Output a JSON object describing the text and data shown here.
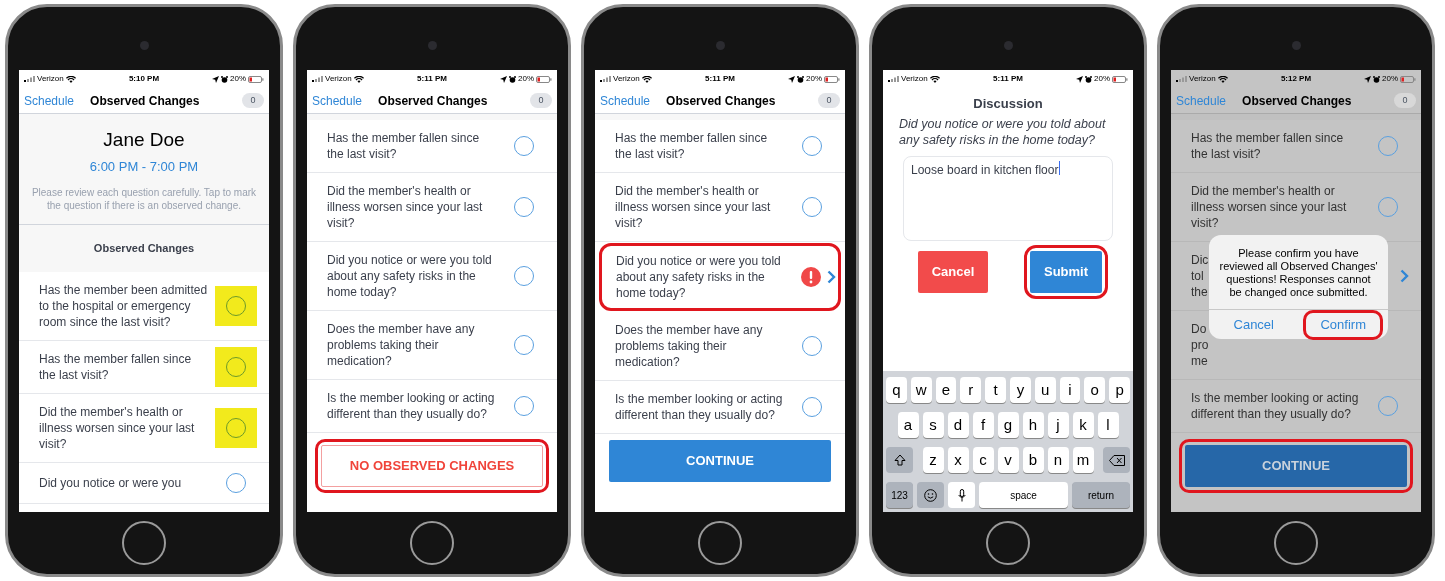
{
  "phones": [
    {
      "kind": "questions",
      "dimmed": false,
      "status_bar": {
        "carrier": "Verizon",
        "time": "5:10 PM",
        "battery": "20%"
      },
      "nav": {
        "back": "Schedule",
        "title": "Observed Changes",
        "badge": "0"
      },
      "member": {
        "name": "Jane Doe",
        "time": "6:00 PM - 7:00 PM",
        "instructions": "Please review each question carefully. Tap to mark the question if there is an observed change."
      },
      "section_title": "Observed Changes",
      "questions": [
        {
          "text": "Has the member been admitted to the hospital or emergency room since the last visit?",
          "marked": false,
          "highlighted": true,
          "outlined": false,
          "covered": false
        },
        {
          "text": "Has the member fallen since the last visit?",
          "marked": false,
          "highlighted": true,
          "outlined": false,
          "covered": false
        },
        {
          "text": "Did the member's health or illness worsen since your last visit?",
          "marked": false,
          "highlighted": true,
          "outlined": false,
          "covered": false
        },
        {
          "text": "Did you notice or were you",
          "marked": false,
          "highlighted": false,
          "outlined": false,
          "covered": false
        }
      ]
    },
    {
      "kind": "questions",
      "dimmed": false,
      "status_bar": {
        "carrier": "Verizon",
        "time": "5:11 PM",
        "battery": "20%"
      },
      "nav": {
        "back": "Schedule",
        "title": "Observed Changes",
        "badge": "0"
      },
      "questions": [
        {
          "text": "Has the member fallen since the last visit?",
          "marked": false,
          "highlighted": false,
          "outlined": false,
          "covered": false
        },
        {
          "text": "Did the member's health or illness worsen since your last visit?",
          "marked": false,
          "highlighted": false,
          "outlined": false,
          "covered": false
        },
        {
          "text": "Did you notice or were you told about any safety risks in the home today?",
          "marked": false,
          "highlighted": false,
          "outlined": false,
          "covered": false
        },
        {
          "text": "Does the member have any problems taking their medication?",
          "marked": false,
          "highlighted": false,
          "outlined": false,
          "covered": false
        },
        {
          "text": "Is the member looking or acting different than they usually do?",
          "marked": false,
          "highlighted": false,
          "outlined": false,
          "covered": false
        }
      ],
      "footer_button": {
        "label": "NO OBSERVED CHANGES",
        "kind": "outline",
        "outlined": true
      }
    },
    {
      "kind": "questions",
      "dimmed": false,
      "status_bar": {
        "carrier": "Verizon",
        "time": "5:11 PM",
        "battery": "20%"
      },
      "nav": {
        "back": "Schedule",
        "title": "Observed Changes",
        "badge": "0"
      },
      "questions": [
        {
          "text": "Has the member fallen since the last visit?",
          "marked": false,
          "highlighted": false,
          "outlined": false,
          "covered": false
        },
        {
          "text": "Did the member's health or illness worsen since your last visit?",
          "marked": false,
          "highlighted": false,
          "outlined": false,
          "covered": false
        },
        {
          "text": "Did you notice or were you told about any safety risks in the home today?",
          "marked": true,
          "highlighted": false,
          "outlined": true,
          "covered": false
        },
        {
          "text": "Does the member have any problems taking their medication?",
          "marked": false,
          "highlighted": false,
          "outlined": false,
          "covered": false
        },
        {
          "text": "Is the member looking or acting different than they usually do?",
          "marked": false,
          "highlighted": false,
          "outlined": false,
          "covered": false
        }
      ],
      "footer_button": {
        "label": "CONTINUE",
        "kind": "solid",
        "outlined": false
      }
    },
    {
      "kind": "discussion",
      "status_bar": {
        "carrier": "Verizon",
        "time": "5:11 PM",
        "battery": "20%"
      },
      "title": "Discussion",
      "question": "Did you notice or were you told about any safety risks in the home today?",
      "answer": "Loose board in kitchen floor",
      "buttons": [
        {
          "label": "Cancel",
          "kind": "cancel",
          "outlined": false
        },
        {
          "label": "Submit",
          "kind": "submit",
          "outlined": true
        }
      ],
      "keyboard": {
        "rows": [
          [
            "q",
            "w",
            "e",
            "r",
            "t",
            "y",
            "u",
            "i",
            "o",
            "p"
          ],
          [
            "a",
            "s",
            "d",
            "f",
            "g",
            "h",
            "j",
            "k",
            "l"
          ],
          [
            "z",
            "x",
            "c",
            "v",
            "b",
            "n",
            "m"
          ]
        ],
        "numbers_key": "123",
        "space_key": "space",
        "return_key": "return"
      }
    },
    {
      "kind": "questions",
      "dimmed": true,
      "status_bar": {
        "carrier": "Verizon",
        "time": "5:12 PM",
        "battery": "20%"
      },
      "nav": {
        "back": "Schedule",
        "title": "Observed Changes",
        "badge": "0"
      },
      "questions": [
        {
          "text": "Has the member fallen since the last visit?",
          "marked": false,
          "highlighted": false,
          "outlined": false,
          "covered": false
        },
        {
          "text": "Did the member's health or illness worsen since your last visit?",
          "marked": false,
          "highlighted": false,
          "outlined": false,
          "covered": false
        },
        {
          "text": "Dic\ntol\nthe",
          "marked": true,
          "highlighted": false,
          "outlined": false,
          "covered": true
        },
        {
          "text": "Do\npro\nme",
          "marked": false,
          "highlighted": false,
          "outlined": false,
          "covered": true
        },
        {
          "text": "Is the member looking or acting different than they usually do?",
          "marked": false,
          "highlighted": false,
          "outlined": false,
          "covered": false
        }
      ],
      "footer_button": {
        "label": "CONTINUE",
        "kind": "solid",
        "outlined": true
      },
      "dialog": {
        "message": "Please confirm you have reviewed all Observed Changes' questions! Responses cannot be changed once submitted.",
        "buttons": [
          {
            "label": "Cancel",
            "outlined": false
          },
          {
            "label": "Confirm",
            "outlined": true
          }
        ]
      }
    }
  ]
}
